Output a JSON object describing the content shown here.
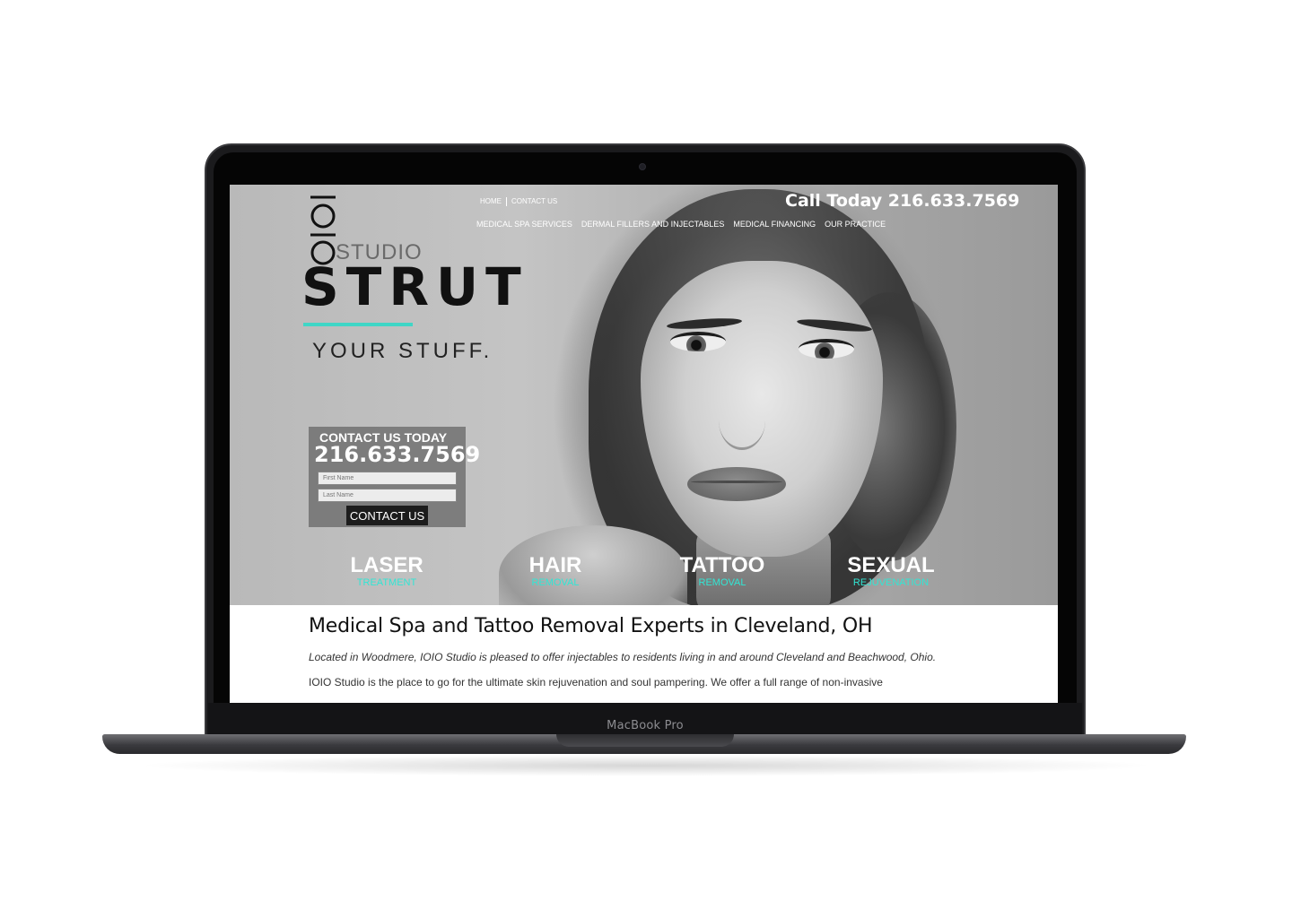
{
  "device": {
    "label": "MacBook Pro"
  },
  "site": {
    "logo": {
      "mark": "IOIO",
      "studio": "STUDIO",
      "headline": "STRUT",
      "tagline": "YOUR STUFF."
    },
    "top_links": [
      "HOME",
      "CONTACT US"
    ],
    "call": "Call Today 216.633.7569",
    "nav": [
      "MEDICAL SPA SERVICES",
      "DERMAL FILLERS AND INJECTABLES",
      "MEDICAL FINANCING",
      "OUR PRACTICE"
    ],
    "contact": {
      "title": "CONTACT US TODAY",
      "phone": "216.633.7569",
      "first_placeholder": "First Name",
      "last_placeholder": "Last Name",
      "button": "CONTACT US"
    },
    "services": [
      {
        "big": "LASER",
        "small": "TREATMENT"
      },
      {
        "big": "HAIR",
        "small": "REMOVAL"
      },
      {
        "big": "TATTOO",
        "small": "REMOVAL"
      },
      {
        "big": "SEXUAL",
        "small": "REJUVENATION"
      }
    ],
    "content": {
      "heading": "Medical Spa and Tattoo Removal Experts in Cleveland, OH",
      "lead": "Located in Woodmere, IOIO Studio is pleased to offer injectables to residents living in and around Cleveland and Beachwood, Ohio.",
      "body": "IOIO Studio is the place to go for the ultimate skin rejuvenation and soul pampering. We offer a full range of non-invasive"
    },
    "colors": {
      "accent": "#3fd6c6",
      "service_sub": "#31e6d4",
      "button": "#1c1c1c"
    }
  }
}
